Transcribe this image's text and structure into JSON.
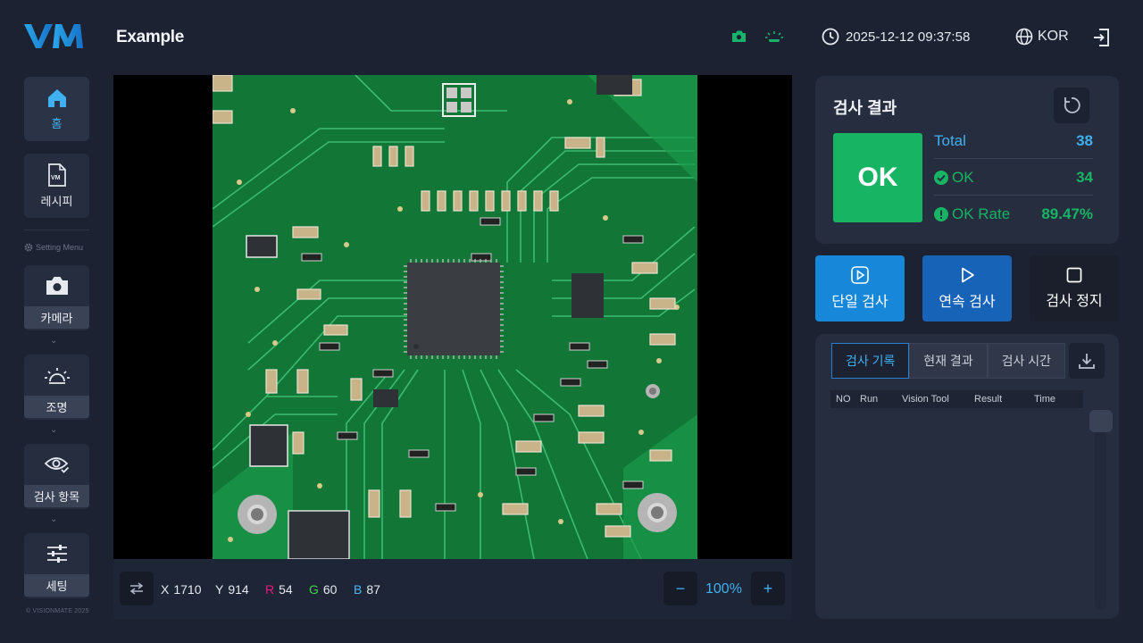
{
  "header": {
    "logo_text": "VM",
    "title": "Example",
    "datetime": "2025-12-12 09:37:58",
    "language": "KOR",
    "icons": [
      "camera-status-icon",
      "light-status-icon",
      "clock-icon",
      "globe-icon",
      "logout-icon"
    ]
  },
  "sidebar": {
    "home_label": "홈",
    "recipe_label": "레시피",
    "setting_menu_label": "Setting Menu",
    "camera_label": "카메라",
    "light_label": "조명",
    "inspection_item_label": "검사 항목",
    "settings_label": "세팅",
    "copyright": "© VISIONMATE 2025"
  },
  "viewer": {
    "x_label": "X",
    "x_value": "1710",
    "y_label": "Y",
    "y_value": "914",
    "r_label": "R",
    "r_value": "54",
    "g_label": "G",
    "g_value": "60",
    "b_label": "B",
    "b_value": "87",
    "zoom_minus": "−",
    "zoom_value": "100%",
    "zoom_plus": "+"
  },
  "result": {
    "title": "검사 결과",
    "status": "OK",
    "total_label": "Total",
    "total_value": "38",
    "ok_label": "OK",
    "ok_value": "34",
    "rate_label": "OK Rate",
    "rate_value": "89.47%"
  },
  "actions": {
    "single": "단일 검사",
    "continuous": "연속 검사",
    "stop": "검사 정지"
  },
  "log": {
    "tabs": [
      "검사 기록",
      "현재 결과",
      "검사 시간"
    ],
    "columns": [
      "NO",
      "Run",
      "Vision Tool",
      "Result",
      "Time"
    ]
  },
  "colors": {
    "accent": "#3fb0f0",
    "ok_green": "#16b463",
    "single_btn": "#1787d9",
    "continuous_btn": "#1663b8",
    "r_color": "#e8177a",
    "g_color": "#3fd34a",
    "b_color": "#4fb6f2"
  }
}
